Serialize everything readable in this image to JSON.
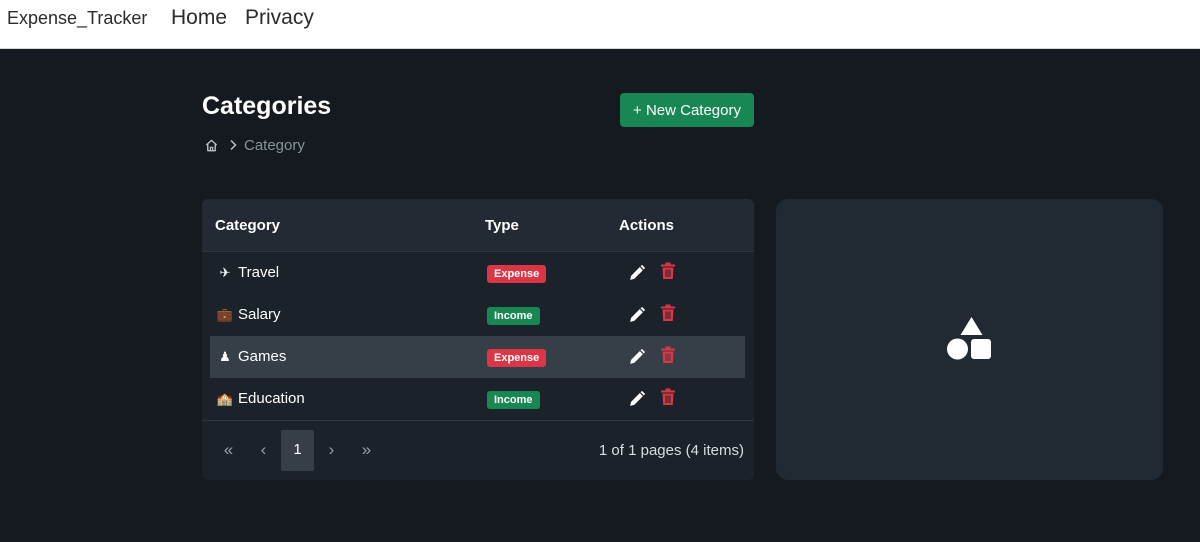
{
  "navbar": {
    "brand": "Expense_Tracker",
    "links": [
      {
        "label": "Home"
      },
      {
        "label": "Privacy"
      }
    ]
  },
  "header": {
    "title": "Categories",
    "new_button_label": "+ New Category",
    "breadcrumb": {
      "home_icon": "home-icon",
      "separator_icon": "chevron-right-icon",
      "current": "Category"
    }
  },
  "table": {
    "columns": [
      "Category",
      "Type",
      "Actions"
    ],
    "rows": [
      {
        "icon": "✈",
        "name": "Travel",
        "type": "Expense"
      },
      {
        "icon": "💼",
        "name": "Salary",
        "type": "Income"
      },
      {
        "icon": "♟",
        "name": "Games",
        "type": "Expense"
      },
      {
        "icon": "🏫",
        "name": "Education",
        "type": "Income"
      }
    ],
    "highlighted_row": 2
  },
  "pagination": {
    "first": "«",
    "prev": "‹",
    "current_page": "1",
    "next": "›",
    "last": "»",
    "info": "1 of 1 pages (4 items)"
  },
  "side_panel": {
    "icon": "shapes-icon"
  },
  "colors": {
    "background": "#151a21",
    "accent_green": "#198754",
    "expense_red": "#dc3545",
    "delete_icon": "#dc3545"
  }
}
